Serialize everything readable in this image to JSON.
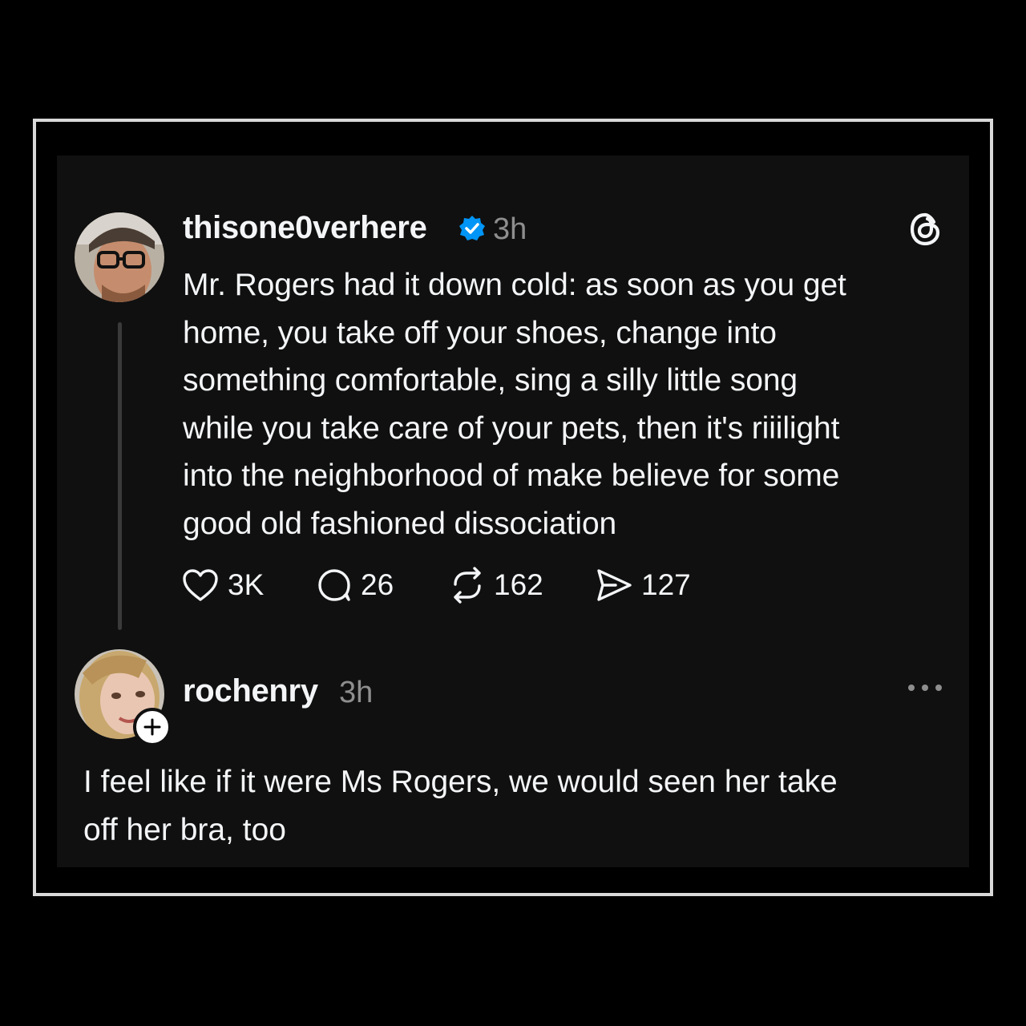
{
  "post": {
    "username": "thisone0verhere",
    "verified_icon": "verified-badge-icon",
    "time": "3h",
    "lines": [
      "Mr. Rogers had it down cold: as soon as you get",
      "home, you take off your shoes, change into",
      "something comfortable, sing a silly little song",
      "while you take care of your pets, then it's riiilight",
      "into the neighborhood of make believe for some",
      "good old fashioned dissociation"
    ],
    "likes": "3K",
    "comments": "26",
    "reposts": "162",
    "shares": "127"
  },
  "reply": {
    "username": "rochenry",
    "time": "3h",
    "lines": [
      "I feel like if it were Ms Rogers, we would seen her take",
      "off her bra, too"
    ]
  },
  "icons": {
    "app_logo": "threads-logo-icon",
    "like": "heart-icon",
    "comment": "comment-bubble-icon",
    "repost": "repost-icon",
    "share": "send-icon",
    "more": "more-dots-icon",
    "follow": "plus-icon"
  },
  "colors": {
    "background": "#000000",
    "card": "#101010",
    "frame_border": "#d9d9d9",
    "text_primary": "#f3f5f7",
    "text_secondary": "#8e8e8e",
    "verified_blue": "#0095f6",
    "thread_line": "#3a3a3a"
  }
}
